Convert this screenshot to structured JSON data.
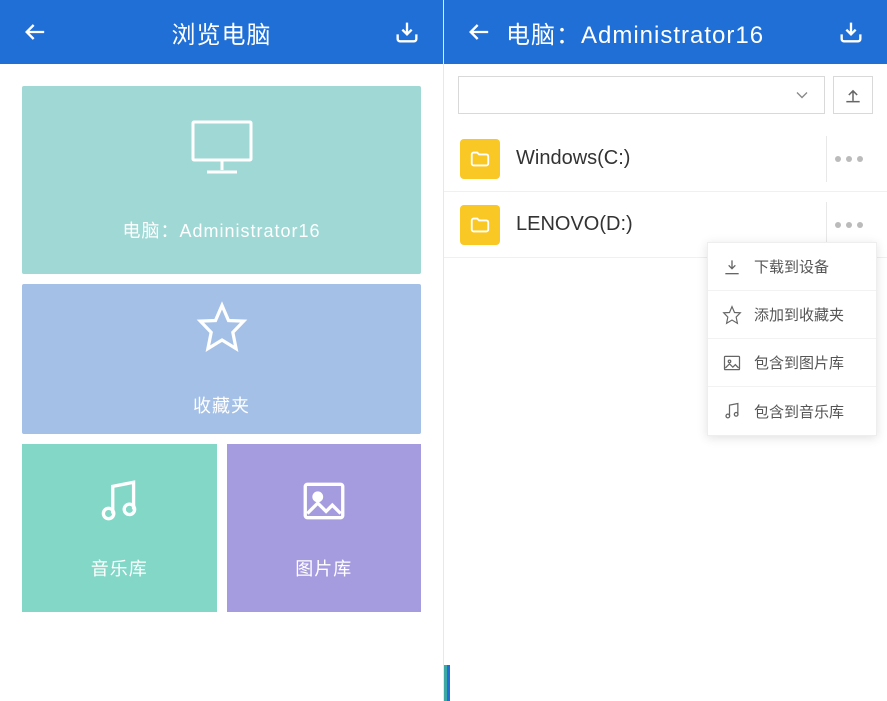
{
  "left": {
    "header_title": "浏览电脑",
    "tiles": {
      "computer_label": "电脑：Administrator16",
      "favorites_label": "收藏夹",
      "music_label": "音乐库",
      "image_label": "图片库"
    }
  },
  "right": {
    "header_title": "电脑：Administrator16",
    "files": [
      {
        "name": "Windows(C:)"
      },
      {
        "name": "LENOVO(D:)"
      }
    ],
    "menu": {
      "download": "下载到设备",
      "favorite": "添加到收藏夹",
      "include_image": "包含到图片库",
      "include_music": "包含到音乐库"
    }
  }
}
